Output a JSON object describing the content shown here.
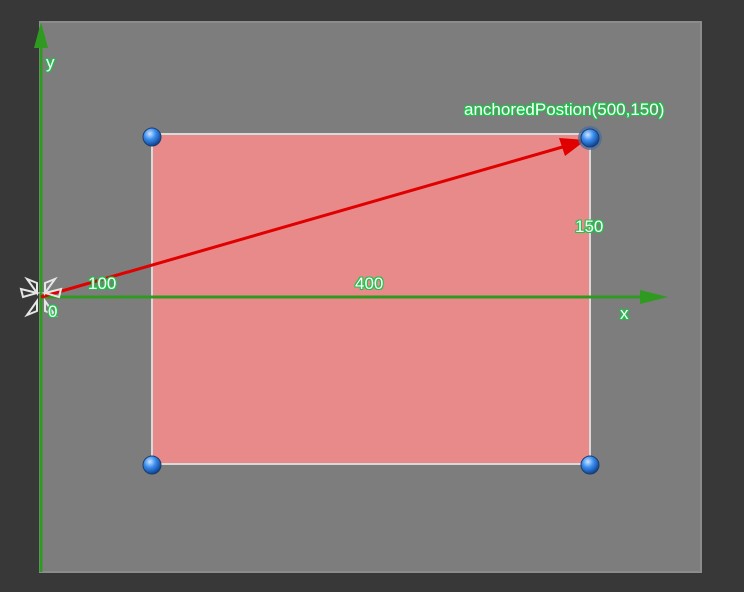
{
  "labels": {
    "y_axis": "y",
    "x_axis": "x",
    "origin": "0",
    "offset_x": "100",
    "width": "400",
    "offset_y": "150",
    "anchored_position": "anchoredPostion(500,150)"
  },
  "colors": {
    "background": "#383838",
    "panel": "#7d7d7d",
    "rect_fill": "#e88a8a",
    "axis": "#2e9a1f",
    "vector": "#e00000",
    "handle": "#2f7fdc",
    "label_outline": "#1fc24a"
  },
  "icons": {
    "pivot": "pivot-cross-icon"
  }
}
